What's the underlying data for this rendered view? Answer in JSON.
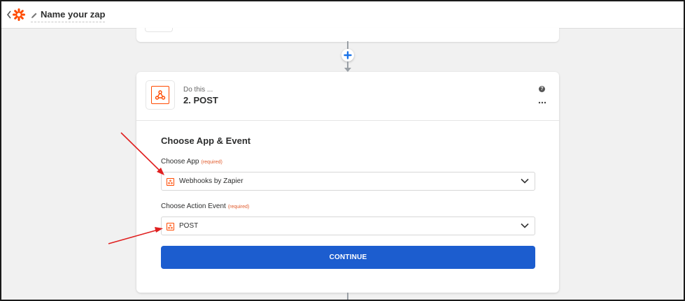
{
  "header": {
    "zap_name": "Name your zap"
  },
  "step": {
    "subtitle": "Do this ...",
    "title": "2. POST"
  },
  "form": {
    "section_title": "Choose App & Event",
    "app_label": "Choose App",
    "app_required": "(required)",
    "app_value": "Webhooks by Zapier",
    "event_label": "Choose Action Event",
    "event_required": "(required)",
    "event_value": "POST",
    "continue_label": "CONTINUE"
  },
  "icons": {
    "back": "chevron-left-icon",
    "logo": "zapier-logo-icon",
    "edit": "pencil-icon",
    "add_step": "plus-icon",
    "app": "webhook-icon",
    "help": "help-icon",
    "more": "more-icon",
    "dropdown": "chevron-down-icon"
  },
  "colors": {
    "brand_orange": "#ff4a00",
    "primary_blue": "#1c5dcf",
    "add_blue": "#1a73e8",
    "annotation_red": "#e02020",
    "required_red": "#e0592a"
  }
}
